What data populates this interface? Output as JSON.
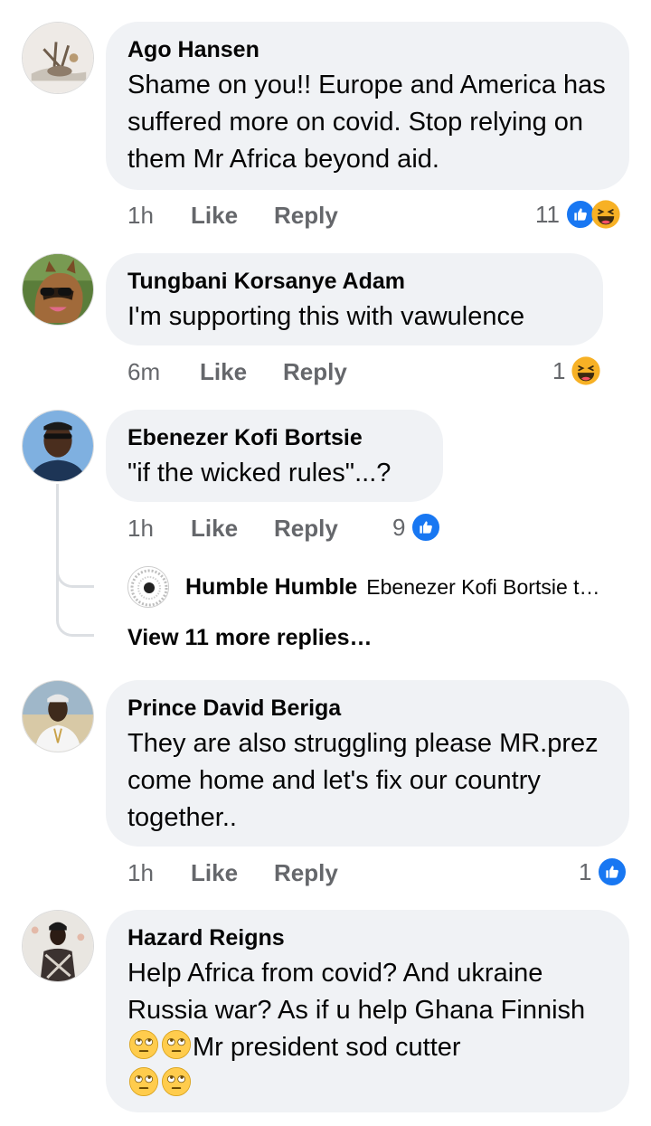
{
  "comments": [
    {
      "author": "Ago Hansen",
      "text": "Shame on you!! Europe and America has suffered more on covid. Stop relying on them Mr Africa beyond aid.",
      "time": "1h",
      "like_label": "Like",
      "reply_label": "Reply",
      "reaction_count": "11",
      "reactions": [
        "like-icon",
        "haha-icon"
      ]
    },
    {
      "author": "Tungbani Korsanye Adam",
      "text": "I'm supporting this with vawulence",
      "time": "6m",
      "like_label": "Like",
      "reply_label": "Reply",
      "reaction_count": "1",
      "reactions": [
        "haha-icon"
      ]
    },
    {
      "author": "Ebenezer Kofi Bortsie",
      "text": "\"if the wicked rules\"...?",
      "time": "1h",
      "like_label": "Like",
      "reply_label": "Reply",
      "reaction_count": "9",
      "reactions": [
        "like-icon"
      ],
      "reply_preview": {
        "author": "Humble Humble",
        "snippet": "Ebenezer Kofi Bortsie t…"
      },
      "view_more_label": "View 11 more replies…"
    },
    {
      "author": "Prince David Beriga",
      "text": "They are also struggling please MR.prez come home and let's fix our country together..",
      "time": "1h",
      "like_label": "Like",
      "reply_label": "Reply",
      "reaction_count": "1",
      "reactions": [
        "like-icon"
      ]
    },
    {
      "author": "Hazard Reigns",
      "text_parts": [
        "Help Africa from covid? And ukraine Russia war? As if u help Ghana Finnish",
        "Mr president sod cutter"
      ],
      "emojis": [
        "eye-roll-emoji"
      ]
    }
  ],
  "colors": {
    "bubble": "#f0f2f5",
    "meta_text": "#65676b",
    "like_blue": "#1877f2",
    "haha_yellow": "#f7b125"
  }
}
